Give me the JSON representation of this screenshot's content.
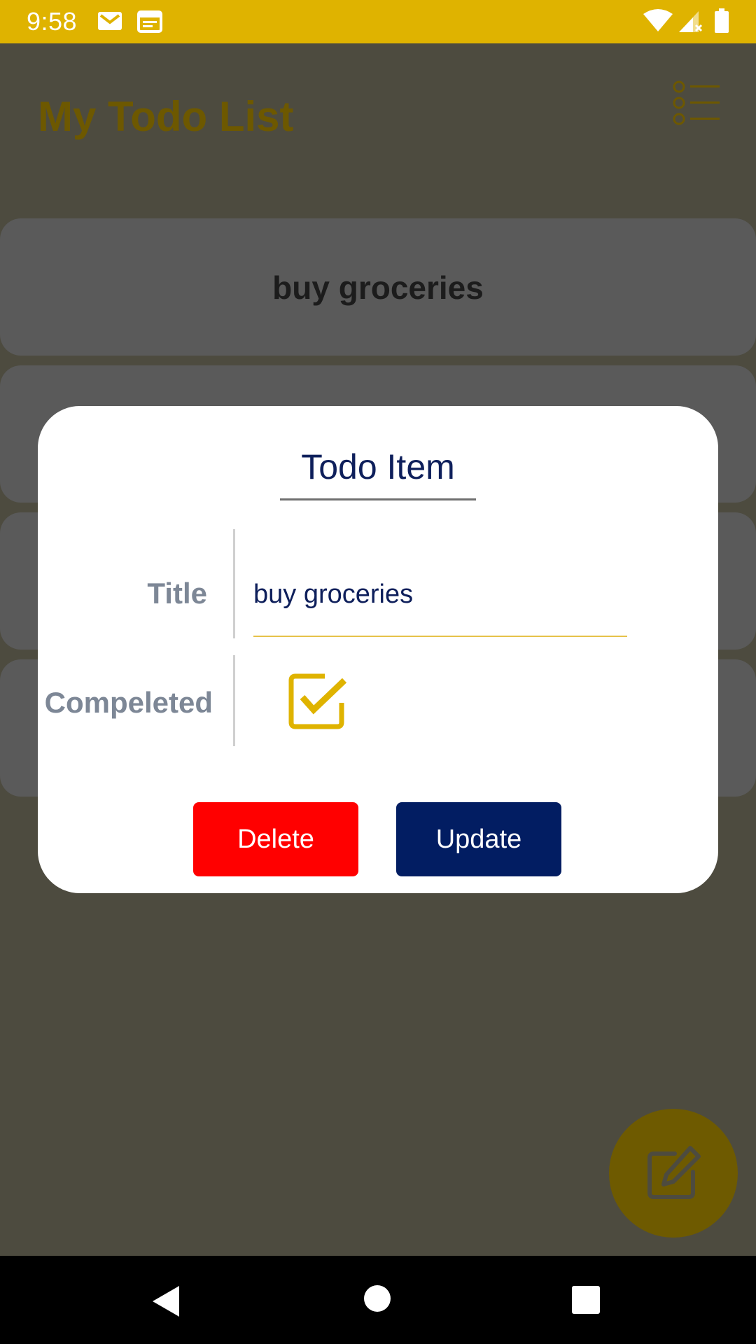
{
  "status_bar": {
    "time": "9:58",
    "icons": [
      "mail-icon",
      "calendar-icon",
      "wifi-icon",
      "signal-icon",
      "battery-icon"
    ]
  },
  "app": {
    "title": "My Todo List",
    "menu_icon": "list-icon",
    "cards": [
      {
        "title": "buy groceries"
      },
      {
        "title": ""
      },
      {
        "title": ""
      },
      {
        "title": ""
      }
    ],
    "fab_icon": "edit-icon"
  },
  "dialog": {
    "title": "Todo Item",
    "title_label": "Title",
    "title_value": "buy groceries",
    "completed_label": "Compeleted",
    "completed_checked": true,
    "delete_label": "Delete",
    "update_label": "Update"
  },
  "nav": {
    "icons": [
      "back-icon",
      "home-icon",
      "recents-icon"
    ]
  },
  "colors": {
    "status_bar": "#dfb300",
    "accent": "#dfb300",
    "delete": "#ff0000",
    "update": "#021d62",
    "dialog_text": "#0e1f5b",
    "label": "#7d8796"
  }
}
